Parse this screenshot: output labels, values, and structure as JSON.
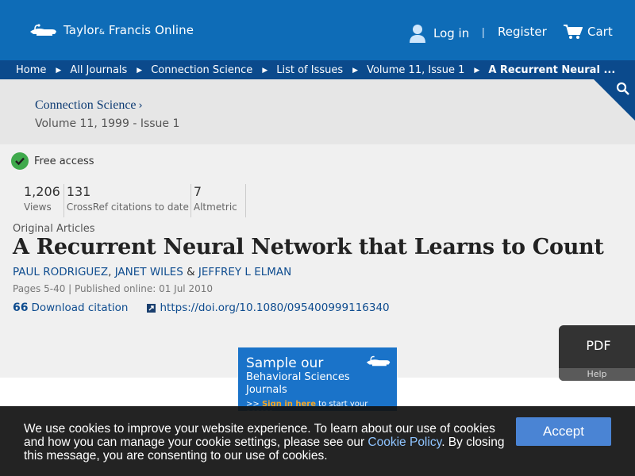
{
  "header": {
    "logo_main": "Taylor",
    "logo_amp": "&",
    "logo_tail": " Francis Online",
    "login_label": "Log in",
    "separator": "|",
    "register_label": "Register",
    "cart_label": "Cart"
  },
  "breadcrumb": {
    "items": [
      "Home",
      "All Journals",
      "Connection Science",
      "List of Issues",
      "Volume 11, Issue 1",
      "A Recurrent Neural ..."
    ]
  },
  "journal": {
    "title": "Connection Science",
    "chevron": "›",
    "issue": "Volume 11, 1999 - Issue 1"
  },
  "access": {
    "label": "Free access"
  },
  "metrics": [
    {
      "value": "1,206",
      "label": "Views"
    },
    {
      "value": "131",
      "label": "CrossRef citations to date"
    },
    {
      "value": "7",
      "label": "Altmetric"
    }
  ],
  "article": {
    "type": "Original Articles",
    "title": "A Recurrent Neural Network that Learns to Count",
    "authors": [
      "PAUL RODRIGUEZ",
      "JANET WILES",
      "JEFFREY L ELMAN"
    ],
    "author_sep_1": ", ",
    "author_sep_2": " & ",
    "pages": "Pages 5-40 | Published online: 01 Jul 2010",
    "download_citation": "Download citation",
    "quote_glyph": "66",
    "doi": "https://doi.org/10.1080/095400999116340"
  },
  "ad": {
    "title": "Sample our",
    "subtitle": "Behavioral Sciences Journals",
    "cta_prefix": ">> ",
    "cta_link": "Sign in here",
    "cta_suffix": " to start your access"
  },
  "pdf_widget": {
    "label": "PDF",
    "help": "Help"
  },
  "cookie": {
    "text_before": "We use cookies to improve your website experience. To learn about our use of cookies and how you can manage your cookie settings, please see our ",
    "link": "Cookie Policy",
    "text_after": ". By closing this message, you are consenting to our use of cookies.",
    "accept_label": "Accept"
  },
  "colors": {
    "header_blue": "#0e6cb7",
    "breadcrumb_navy": "#0b4a8c",
    "link_blue": "#0e4c8f",
    "free_green": "#3fa94c",
    "accept_blue": "#4a84d4"
  },
  "icons": [
    "lamp-logo-icon",
    "user-icon",
    "cart-icon",
    "search-icon",
    "check-icon",
    "quote-icon",
    "external-link-icon"
  ]
}
